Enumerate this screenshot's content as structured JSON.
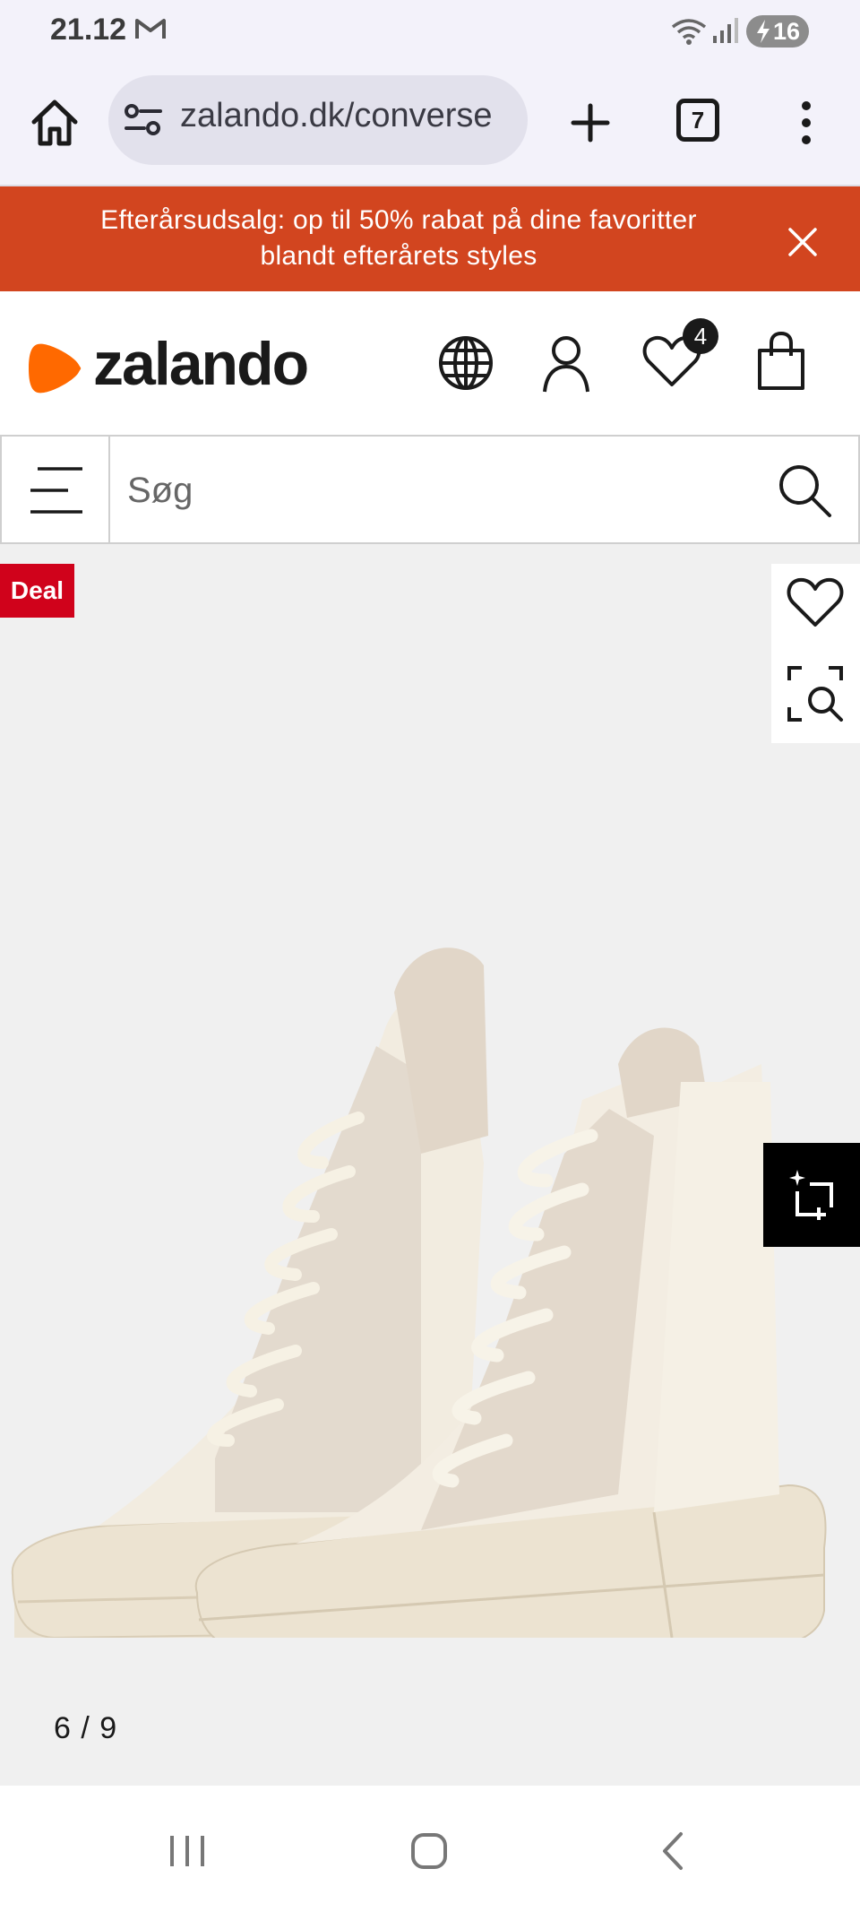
{
  "status_bar": {
    "time": "21.12",
    "battery_level": "16",
    "icons": [
      "gmail-icon",
      "wifi-icon",
      "signal-icon",
      "battery-charging-icon"
    ]
  },
  "browser": {
    "url": "zalando.dk/converse",
    "tab_count": "7",
    "icons": [
      "home-icon",
      "site-settings-icon",
      "new-tab-icon",
      "tabs-icon",
      "overflow-menu-icon"
    ]
  },
  "promo_banner": {
    "text": "Efterårsudsalg: op til 50% rabat på dine favoritter blandt efterårets styles",
    "background": "#d2451f"
  },
  "header": {
    "brand": "zalando",
    "brand_color": "#ff6900",
    "wishlist_count": "4",
    "icons": [
      "globe-icon",
      "account-icon",
      "heart-icon",
      "shopping-bag-icon"
    ]
  },
  "search": {
    "placeholder": "Søg",
    "value": ""
  },
  "gallery": {
    "deal_label": "Deal",
    "deal_color": "#d0021b",
    "counter": "6 / 9",
    "current_image": 6,
    "total_images": 9,
    "product_image": "cream-high-top-platform-sneakers"
  },
  "nav_bar": {
    "icons": [
      "recent-apps-icon",
      "home-nav-icon",
      "back-icon"
    ]
  }
}
